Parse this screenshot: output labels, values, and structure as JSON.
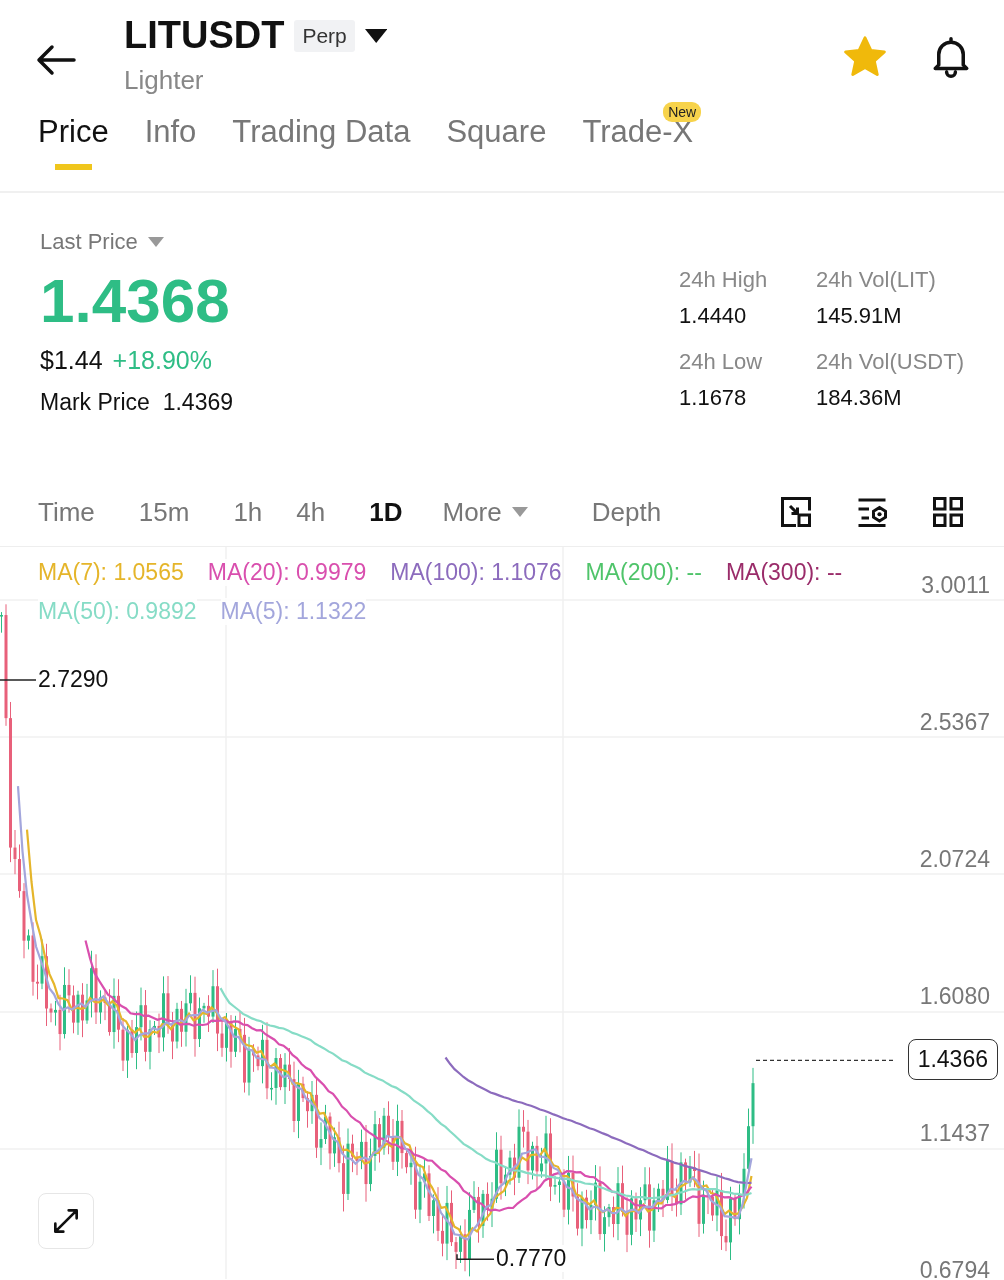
{
  "header": {
    "symbol": "LITUSDT",
    "badge": "Perp",
    "subtitle": "Lighter",
    "favorited": true
  },
  "tabs": [
    {
      "label": "Price",
      "selected": true
    },
    {
      "label": "Info",
      "selected": false
    },
    {
      "label": "Trading Data",
      "selected": false
    },
    {
      "label": "Square",
      "selected": false
    },
    {
      "label": "Trade-X",
      "selected": false,
      "badge": "New"
    }
  ],
  "price": {
    "label": "Last Price",
    "last": "1.4368",
    "usd": "$1.44",
    "change": "+18.90%",
    "mark_label": "Mark Price",
    "mark": "1.4369"
  },
  "stats": [
    {
      "label": "24h High",
      "value": "1.4440"
    },
    {
      "label": "24h Vol(LIT)",
      "value": "145.91M"
    },
    {
      "label": "24h Low",
      "value": "1.1678"
    },
    {
      "label": "24h Vol(USDT)",
      "value": "184.36M"
    }
  ],
  "intervals": [
    {
      "label": "Time",
      "selected": false
    },
    {
      "label": "15m",
      "selected": false
    },
    {
      "label": "1h",
      "selected": false
    },
    {
      "label": "4h",
      "selected": false
    },
    {
      "label": "1D",
      "selected": true
    },
    {
      "label": "More",
      "selected": false,
      "dropdown": true
    },
    {
      "label": "Depth",
      "selected": false
    }
  ],
  "chart": {
    "ma": [
      {
        "label": "MA(7): 1.0565",
        "color": "#e5b52a"
      },
      {
        "label": "MA(20): 0.9979",
        "color": "#d94fae"
      },
      {
        "label": "MA(100): 1.1076",
        "color": "#8c6bbd"
      },
      {
        "label": "MA(200): --",
        "color": "#4fc46a"
      },
      {
        "label": "MA(300): --",
        "color": "#9a2c6a"
      },
      {
        "label": "MA(50): 0.9892",
        "color": "#86dcc6"
      },
      {
        "label": "MA(5): 1.1322",
        "color": "#a3a6dc"
      }
    ],
    "price_axis": [
      "3.0011",
      "2.5367",
      "2.0724",
      "1.6080",
      "1.1437",
      "0.6794"
    ],
    "high_marker": "2.7290",
    "low_marker": "0.7770",
    "last_marker": "1.4366"
  }
}
